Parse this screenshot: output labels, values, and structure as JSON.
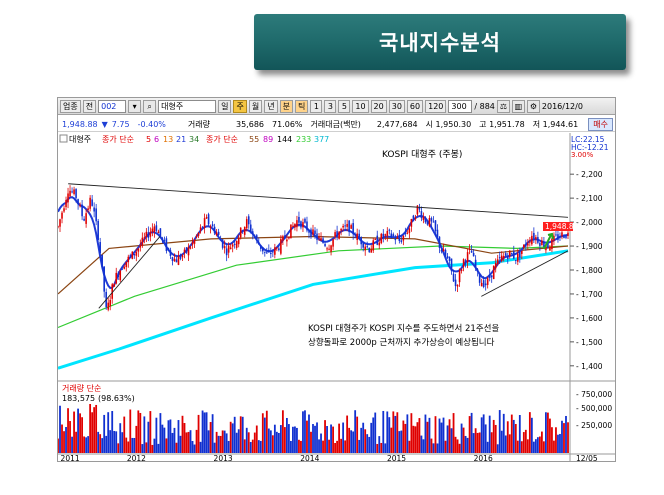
{
  "slide_title": "국내지수분석",
  "toolbar": {
    "item1": "업종",
    "item2": "전",
    "code": "002",
    "name": "대형주",
    "periods": [
      "일",
      "주",
      "월",
      "년",
      "분",
      "틱"
    ],
    "minutes": [
      "1",
      "3",
      "5",
      "10",
      "20",
      "30",
      "60",
      "120"
    ],
    "count": "300",
    "range": "/ 884",
    "date": "2016/12/0"
  },
  "quote": {
    "price": "1,948.88",
    "arrow": "▼",
    "change": "7.75",
    "pct": "-0.40%",
    "vol_label": "거래량",
    "volume": "35,686",
    "vol_pct": "71.06%",
    "amt_label": "거래대금(백만)",
    "amount": "2,477,684",
    "open": "시 1,950.30",
    "high": "고 1,951.78",
    "low": "저 1,944.61",
    "buy_label": "매수"
  },
  "legend": {
    "name": "대형주",
    "ma_short_label": "종가 단순",
    "ma_short": [
      "5",
      "6",
      "13",
      "21",
      "34"
    ],
    "ma_long_label": "종가 단순",
    "ma_long": [
      "55",
      "89",
      "144",
      "233",
      "377"
    ],
    "lc": "LC:22.15",
    "hc": "HC:-12.21",
    "pct_tag": "3.00%",
    "price_tag": "1,948.88"
  },
  "chart_title": "KOSPI 대형주 (주봉)",
  "annotation": {
    "line1": "KOSPI 대형주가 KOSPI 지수를 주도하면서 21주선을",
    "line2": "상향돌파로 2000p 근처까지 추가상승이 예상됩니다"
  },
  "volume_panel": {
    "label": "거래량 단순",
    "value": "183,575",
    "pct": "(98.63%)",
    "ticks": [
      "750,000",
      "500,000",
      "250,000"
    ]
  },
  "colors": {
    "banner": "#1f6a6b",
    "up": "#e00000",
    "down": "#1030d0",
    "ma_blue": "#1f3ad6",
    "ma_cyan": "#00e5ff",
    "ma_green": "#33cc33",
    "ma_brown": "#8b4513"
  },
  "chart_data": {
    "type": "candlestick",
    "title": "KOSPI 대형주 (주봉)",
    "x_ticks": [
      "2011",
      "2012",
      "2013",
      "2014",
      "2015",
      "2016",
      "12/05"
    ],
    "y_ticks": [
      2200,
      2100,
      2000,
      1900,
      1800,
      1700,
      1600,
      1500,
      1400
    ],
    "ylim": [
      1370,
      2255
    ],
    "price_path": [
      {
        "t": 0.0,
        "v": 1980
      },
      {
        "t": 0.02,
        "v": 2140
      },
      {
        "t": 0.035,
        "v": 2110
      },
      {
        "t": 0.05,
        "v": 2010
      },
      {
        "t": 0.065,
        "v": 2100
      },
      {
        "t": 0.08,
        "v": 1930
      },
      {
        "t": 0.095,
        "v": 1620
      },
      {
        "t": 0.11,
        "v": 1760
      },
      {
        "t": 0.13,
        "v": 1830
      },
      {
        "t": 0.15,
        "v": 1870
      },
      {
        "t": 0.17,
        "v": 1930
      },
      {
        "t": 0.19,
        "v": 1990
      },
      {
        "t": 0.21,
        "v": 1900
      },
      {
        "t": 0.23,
        "v": 1840
      },
      {
        "t": 0.25,
        "v": 1870
      },
      {
        "t": 0.27,
        "v": 1930
      },
      {
        "t": 0.29,
        "v": 2010
      },
      {
        "t": 0.31,
        "v": 1960
      },
      {
        "t": 0.33,
        "v": 1880
      },
      {
        "t": 0.35,
        "v": 1930
      },
      {
        "t": 0.37,
        "v": 2000
      },
      {
        "t": 0.39,
        "v": 1920
      },
      {
        "t": 0.41,
        "v": 1860
      },
      {
        "t": 0.43,
        "v": 1890
      },
      {
        "t": 0.45,
        "v": 1950
      },
      {
        "t": 0.47,
        "v": 2010
      },
      {
        "t": 0.49,
        "v": 1970
      },
      {
        "t": 0.51,
        "v": 1930
      },
      {
        "t": 0.53,
        "v": 1900
      },
      {
        "t": 0.55,
        "v": 1960
      },
      {
        "t": 0.57,
        "v": 1980
      },
      {
        "t": 0.59,
        "v": 1930
      },
      {
        "t": 0.61,
        "v": 1890
      },
      {
        "t": 0.63,
        "v": 1930
      },
      {
        "t": 0.65,
        "v": 1950
      },
      {
        "t": 0.67,
        "v": 1920
      },
      {
        "t": 0.69,
        "v": 1980
      },
      {
        "t": 0.705,
        "v": 2060
      },
      {
        "t": 0.72,
        "v": 2010
      },
      {
        "t": 0.735,
        "v": 1990
      },
      {
        "t": 0.75,
        "v": 1890
      },
      {
        "t": 0.765,
        "v": 1840
      },
      {
        "t": 0.78,
        "v": 1730
      },
      {
        "t": 0.795,
        "v": 1840
      },
      {
        "t": 0.81,
        "v": 1880
      },
      {
        "t": 0.825,
        "v": 1760
      },
      {
        "t": 0.84,
        "v": 1740
      },
      {
        "t": 0.855,
        "v": 1810
      },
      {
        "t": 0.87,
        "v": 1850
      },
      {
        "t": 0.885,
        "v": 1870
      },
      {
        "t": 0.9,
        "v": 1850
      },
      {
        "t": 0.915,
        "v": 1900
      },
      {
        "t": 0.93,
        "v": 1950
      },
      {
        "t": 0.945,
        "v": 1920
      },
      {
        "t": 0.96,
        "v": 1900
      },
      {
        "t": 0.975,
        "v": 1930
      },
      {
        "t": 0.99,
        "v": 1949
      }
    ],
    "ma_curves": [
      {
        "color": "#00e5ff",
        "points": [
          [
            0,
            1390
          ],
          [
            0.12,
            1470
          ],
          [
            0.3,
            1600
          ],
          [
            0.5,
            1740
          ],
          [
            0.7,
            1810
          ],
          [
            0.85,
            1830
          ],
          [
            1.0,
            1880
          ]
        ]
      },
      {
        "color": "#33cc33",
        "points": [
          [
            0,
            1560
          ],
          [
            0.15,
            1690
          ],
          [
            0.35,
            1820
          ],
          [
            0.55,
            1880
          ],
          [
            0.75,
            1900
          ],
          [
            0.9,
            1890
          ],
          [
            1.0,
            1900
          ]
        ]
      },
      {
        "color": "#8b4513",
        "points": [
          [
            0,
            1700
          ],
          [
            0.1,
            1890
          ],
          [
            0.3,
            1930
          ],
          [
            0.5,
            1940
          ],
          [
            0.7,
            1930
          ],
          [
            0.85,
            1870
          ],
          [
            1.0,
            1900
          ]
        ]
      }
    ],
    "trendlines": [
      {
        "from": [
          0.02,
          2160
        ],
        "to": [
          1.0,
          2020
        ]
      },
      {
        "from": [
          0.08,
          1640
        ],
        "to": [
          0.2,
          1940
        ]
      },
      {
        "from": [
          0.83,
          1690
        ],
        "to": [
          1.0,
          1880
        ]
      }
    ],
    "volume_series_max": 750000
  }
}
